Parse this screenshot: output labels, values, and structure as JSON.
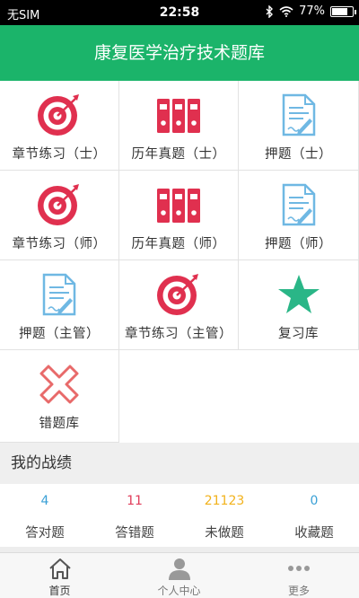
{
  "status_bar": {
    "carrier": "无SIM",
    "time": "22:58",
    "battery": "77%",
    "battery_level": 0.77
  },
  "header": {
    "title": "康复医学治疗技术题库"
  },
  "grid": {
    "items": [
      {
        "label": "章节练习（士）",
        "icon": "target-icon"
      },
      {
        "label": "历年真题（士）",
        "icon": "binders-icon"
      },
      {
        "label": "押题（士）",
        "icon": "document-pen-icon"
      },
      {
        "label": "章节练习（师）",
        "icon": "target-icon"
      },
      {
        "label": "历年真题（师）",
        "icon": "binders-icon"
      },
      {
        "label": "押题（师）",
        "icon": "document-pen-icon"
      },
      {
        "label": "押题（主管）",
        "icon": "document-pen-icon"
      },
      {
        "label": "章节练习（主管）",
        "icon": "target-icon"
      },
      {
        "label": "复习库",
        "icon": "star-icon"
      },
      {
        "label": "错题库",
        "icon": "cross-icon"
      }
    ]
  },
  "stats_section": {
    "title": "我的战绩",
    "items": [
      {
        "value": "4",
        "label": "答对题",
        "color": "#3aa0d6"
      },
      {
        "value": "11",
        "label": "答错题",
        "color": "#e03c5a"
      },
      {
        "value": "21123",
        "label": "未做题",
        "color": "#f2b21b"
      },
      {
        "value": "0",
        "label": "收藏题",
        "color": "#3aa0d6"
      }
    ]
  },
  "tabbar": {
    "items": [
      {
        "label": "首页",
        "icon": "home-icon"
      },
      {
        "label": "个人中心",
        "icon": "person-icon"
      },
      {
        "label": "更多",
        "icon": "more-dots-icon"
      }
    ]
  },
  "colors": {
    "brand_green": "#1bb46a",
    "target_red": "#e0304f",
    "doc_blue": "#6fb8e3",
    "star_green": "#2ab687",
    "cross_red": "#e86a6a"
  }
}
